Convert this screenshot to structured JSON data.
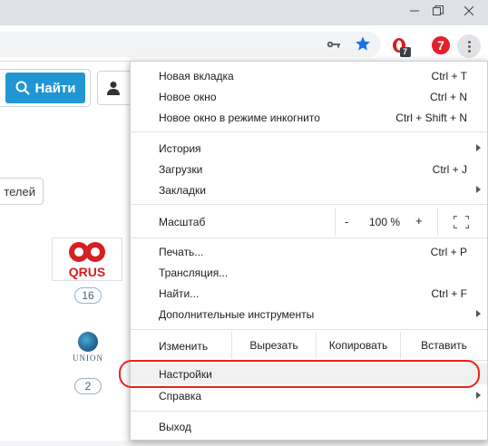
{
  "page": {
    "search_button_label": "Найти",
    "partners_tab_label": "телей",
    "qrus_logo_text": "QRUS",
    "qrus_count": "16",
    "union_logo_text": "UNION",
    "union_count": "2"
  },
  "toolbar": {
    "extension_badge": "7",
    "seven_extension_label": "7"
  },
  "menu": {
    "new_tab": {
      "label": "Новая вкладка",
      "shortcut": "Ctrl + T"
    },
    "new_window": {
      "label": "Новое окно",
      "shortcut": "Ctrl + N"
    },
    "incognito": {
      "label": "Новое окно в режиме инкогнито",
      "shortcut": "Ctrl + Shift + N"
    },
    "history": {
      "label": "История"
    },
    "downloads": {
      "label": "Загрузки",
      "shortcut": "Ctrl + J"
    },
    "bookmarks": {
      "label": "Закладки"
    },
    "zoom": {
      "label": "Масштаб",
      "minus": "-",
      "value": "100 %",
      "plus": "+"
    },
    "print": {
      "label": "Печать...",
      "shortcut": "Ctrl + P"
    },
    "cast": {
      "label": "Трансляция..."
    },
    "find": {
      "label": "Найти...",
      "shortcut": "Ctrl + F"
    },
    "more_tools": {
      "label": "Дополнительные инструменты"
    },
    "edit": {
      "label": "Изменить",
      "cut": "Вырезать",
      "copy": "Копировать",
      "paste": "Вставить"
    },
    "settings": {
      "label": "Настройки"
    },
    "help": {
      "label": "Справка"
    },
    "exit": {
      "label": "Выход"
    }
  },
  "colors": {
    "accent_blue": "#2196d3",
    "highlight_ring": "#e8231c",
    "menu_hover": "#f1f1f1"
  }
}
